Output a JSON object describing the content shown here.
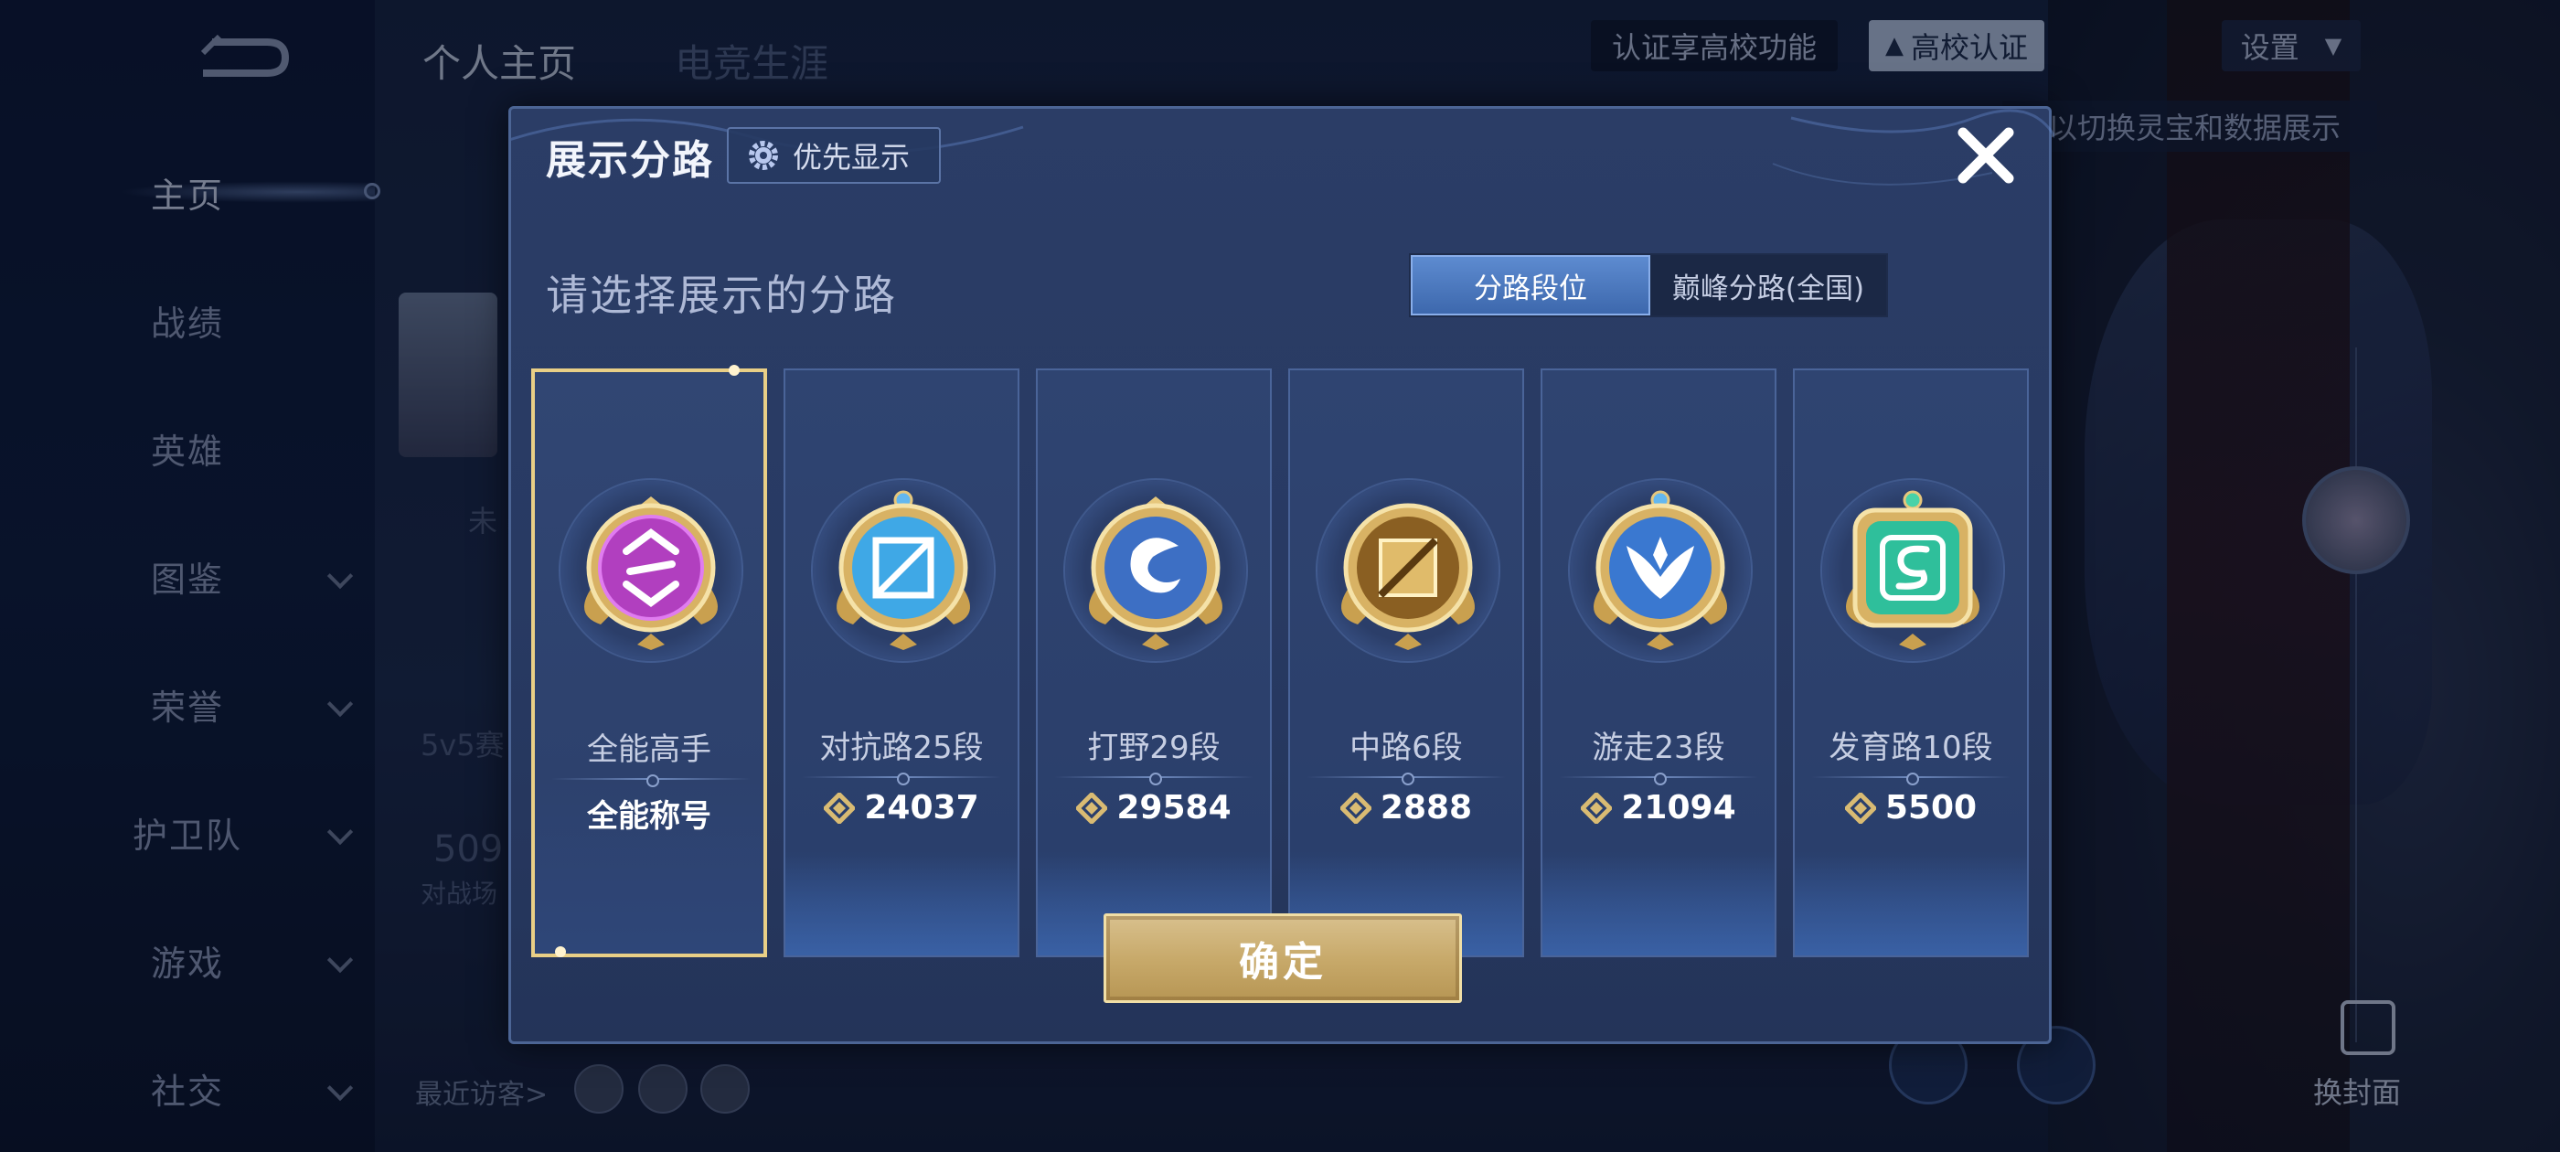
{
  "background": {
    "sidebar": [
      {
        "label": "主页",
        "active": true,
        "has_chevron": false
      },
      {
        "label": "战绩",
        "active": false,
        "has_chevron": false
      },
      {
        "label": "英雄",
        "active": false,
        "has_chevron": false
      },
      {
        "label": "图鉴",
        "active": false,
        "has_chevron": true
      },
      {
        "label": "荣誉",
        "active": false,
        "has_chevron": true
      },
      {
        "label": "护卫队",
        "active": false,
        "has_chevron": true
      },
      {
        "label": "游戏",
        "active": false,
        "has_chevron": true
      },
      {
        "label": "社交",
        "active": false,
        "has_chevron": true
      }
    ],
    "top_tabs": [
      "个人主页",
      "电竞生涯"
    ],
    "campus_hint": "认证享高校功能",
    "campus_button": "高校认证",
    "settings": "设置",
    "switch_hint": "以切换灵宝和数据展示",
    "faded_texts": [
      "未",
      "5v5赛",
      "509",
      "对战场"
    ],
    "recent_visitors": "最近访客>",
    "change_cover": "换封面"
  },
  "dialog": {
    "title": "展示分路",
    "priority_button": "优先显示",
    "subtitle": "请选择展示的分路",
    "toggle": {
      "option_1": "分路段位",
      "option_2": "巅峰分路(全国)",
      "selected": "分路段位"
    },
    "lanes": [
      {
        "name": "全能高手",
        "value": "全能称号",
        "icon": "allround-emblem-icon",
        "color": "#b13fbf",
        "selected": true,
        "has_points": false
      },
      {
        "name": "对抗路25段",
        "value": "24037",
        "icon": "clash-lane-emblem-icon",
        "color": "#3fa8e6",
        "selected": false,
        "has_points": true
      },
      {
        "name": "打野29段",
        "value": "29584",
        "icon": "jungle-emblem-icon",
        "color": "#3d6fc4",
        "selected": false,
        "has_points": true
      },
      {
        "name": "中路6段",
        "value": "2888",
        "icon": "mid-lane-emblem-icon",
        "color": "#c9a04f",
        "selected": false,
        "has_points": true
      },
      {
        "name": "游走23段",
        "value": "21094",
        "icon": "roam-emblem-icon",
        "color": "#3a78d0",
        "selected": false,
        "has_points": true
      },
      {
        "name": "发育路10段",
        "value": "5500",
        "icon": "farm-lane-emblem-icon",
        "color": "#2fbf9b",
        "selected": false,
        "has_points": true
      }
    ],
    "confirm": "确定"
  }
}
